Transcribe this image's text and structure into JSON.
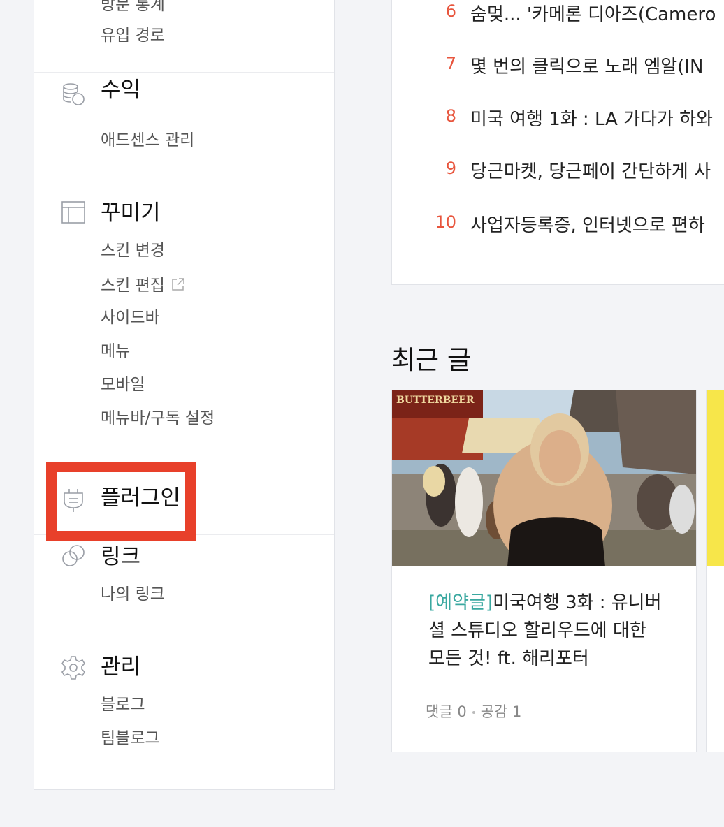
{
  "sidebar": {
    "stats": {
      "items": [
        "방문 통계",
        "유입 경로"
      ]
    },
    "revenue": {
      "title": "수익",
      "icon": "coins-icon",
      "items": [
        "애드센스 관리"
      ]
    },
    "design": {
      "title": "꾸미기",
      "icon": "layout-icon",
      "items": [
        "스킨 변경",
        "스킨 편집",
        "사이드바",
        "메뉴",
        "모바일",
        "메뉴바/구독 설정"
      ]
    },
    "plugin": {
      "title": "플러그인",
      "icon": "plug-icon"
    },
    "link": {
      "title": "링크",
      "icon": "link-icon",
      "items": [
        "나의 링크"
      ]
    },
    "manage": {
      "title": "관리",
      "icon": "gear-icon",
      "items": [
        "블로그",
        "팀블로그"
      ]
    }
  },
  "popular": {
    "items": [
      {
        "rank": "6",
        "title": "숨멎... '카메론 디아즈(Camero"
      },
      {
        "rank": "7",
        "title": "몇 번의 클릭으로 노래 엠알(IN"
      },
      {
        "rank": "8",
        "title": "미국 여행 1화 : LA 가다가 하와"
      },
      {
        "rank": "9",
        "title": "당근마켓, 당근페이 간단하게 사"
      },
      {
        "rank": "10",
        "title": "사업자등록증, 인터넷으로 편하"
      }
    ]
  },
  "recent": {
    "heading": "최근 글",
    "card": {
      "tag": "[예약글]",
      "title": "미국여행 3화 : 유니버셜 스튜디오 할리우드에 대한 모든 것! ft. 해리포터",
      "comments": "댓글 0",
      "likes": "공감 1",
      "image_sign": "BUTTERBEER"
    }
  },
  "colors": {
    "highlight": "#e8402a",
    "rank": "#e8553d",
    "tag": "#3aa8a0"
  }
}
